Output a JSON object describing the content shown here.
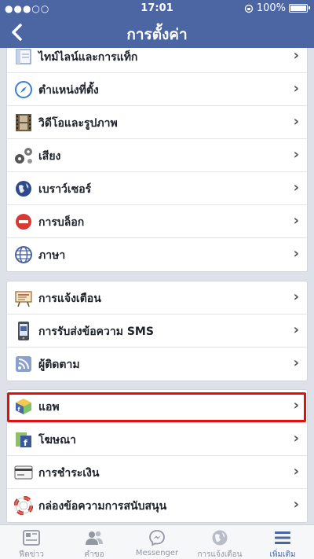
{
  "status_bar": {
    "carrier": "●●●○○",
    "time": "17:01",
    "battery": "100%"
  },
  "nav": {
    "back_icon": "chevron-left-icon",
    "title": "การตั้งค่า"
  },
  "groups": [
    {
      "items": [
        {
          "label": "ไทม์ไลน์และการแท็ก",
          "icon": "timeline-icon"
        },
        {
          "label": "ตำแหน่งที่ตั้ง",
          "icon": "compass-icon"
        },
        {
          "label": "วิดีโอและรูปภาพ",
          "icon": "film-icon"
        },
        {
          "label": "เสียง",
          "icon": "gears-icon"
        },
        {
          "label": "เบราว์เซอร์",
          "icon": "globe-icon"
        },
        {
          "label": "การบล็อก",
          "icon": "block-icon"
        },
        {
          "label": "ภาษา",
          "icon": "language-icon"
        }
      ]
    },
    {
      "items": [
        {
          "label": "การแจ้งเตือน",
          "icon": "notification-board-icon"
        },
        {
          "label": "การรับส่งข้อความ SMS",
          "icon": "phone-sms-icon"
        },
        {
          "label": "ผู้ติดตาม",
          "icon": "rss-icon"
        }
      ]
    },
    {
      "items": [
        {
          "label": "แอพ",
          "icon": "app-cube-icon"
        },
        {
          "label": "โฆษณา",
          "icon": "ads-icon"
        },
        {
          "label": "การชำระเงิน",
          "icon": "credit-card-icon"
        },
        {
          "label": "กล่องข้อความการสนับสนุน",
          "icon": "lifebuoy-icon"
        }
      ]
    }
  ],
  "tabs": [
    {
      "label": "ฟีดข่าว",
      "icon": "news-feed-icon"
    },
    {
      "label": "คำขอ",
      "icon": "friend-requests-icon"
    },
    {
      "label": "Messenger",
      "icon": "messenger-icon"
    },
    {
      "label": "การแจ้งเตือน",
      "icon": "globe-notifications-icon"
    },
    {
      "label": "เพิ่มเติม",
      "icon": "menu-icon",
      "active": true
    }
  ],
  "colors": {
    "brand": "#4c66a4",
    "highlight": "#e01010",
    "background": "#dfe1e8"
  }
}
